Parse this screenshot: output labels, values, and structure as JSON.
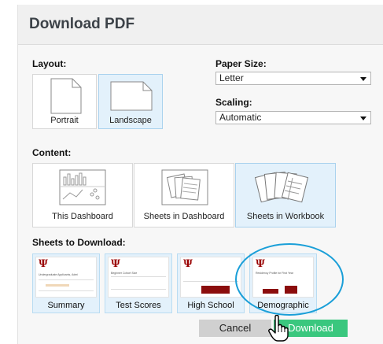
{
  "dialog": {
    "title": "Download PDF"
  },
  "layout": {
    "label": "Layout:",
    "options": [
      {
        "label": "Portrait",
        "selected": false
      },
      {
        "label": "Landscape",
        "selected": true
      }
    ]
  },
  "paper_size": {
    "label": "Paper Size:",
    "value": "Letter"
  },
  "scaling": {
    "label": "Scaling:",
    "value": "Automatic"
  },
  "content": {
    "label": "Content:",
    "options": [
      {
        "label": "This Dashboard",
        "selected": false
      },
      {
        "label": "Sheets in Dashboard",
        "selected": false
      },
      {
        "label": "Sheets in Workbook",
        "selected": true
      }
    ]
  },
  "sheets": {
    "label": "Sheets to Download:",
    "items": [
      {
        "label": "Summary",
        "logo": "Ψ",
        "caption_text": "Undergraduate Applicants, Admi"
      },
      {
        "label": "Test Scores",
        "logo": "Ψ",
        "caption_text": "Beginner Cohort Size"
      },
      {
        "label": "High School",
        "logo": "Ψ",
        "caption_text": ""
      },
      {
        "label": "Demographic",
        "logo": "Ψ",
        "caption_text": "Residency Profile for First Year"
      }
    ]
  },
  "buttons": {
    "cancel": "Cancel",
    "download": "Download"
  },
  "colors": {
    "accent_green": "#3ac77e",
    "selected_bg": "#e3f1fb",
    "annotation_circle": "#1a9fd8",
    "logo_red": "#990000"
  }
}
